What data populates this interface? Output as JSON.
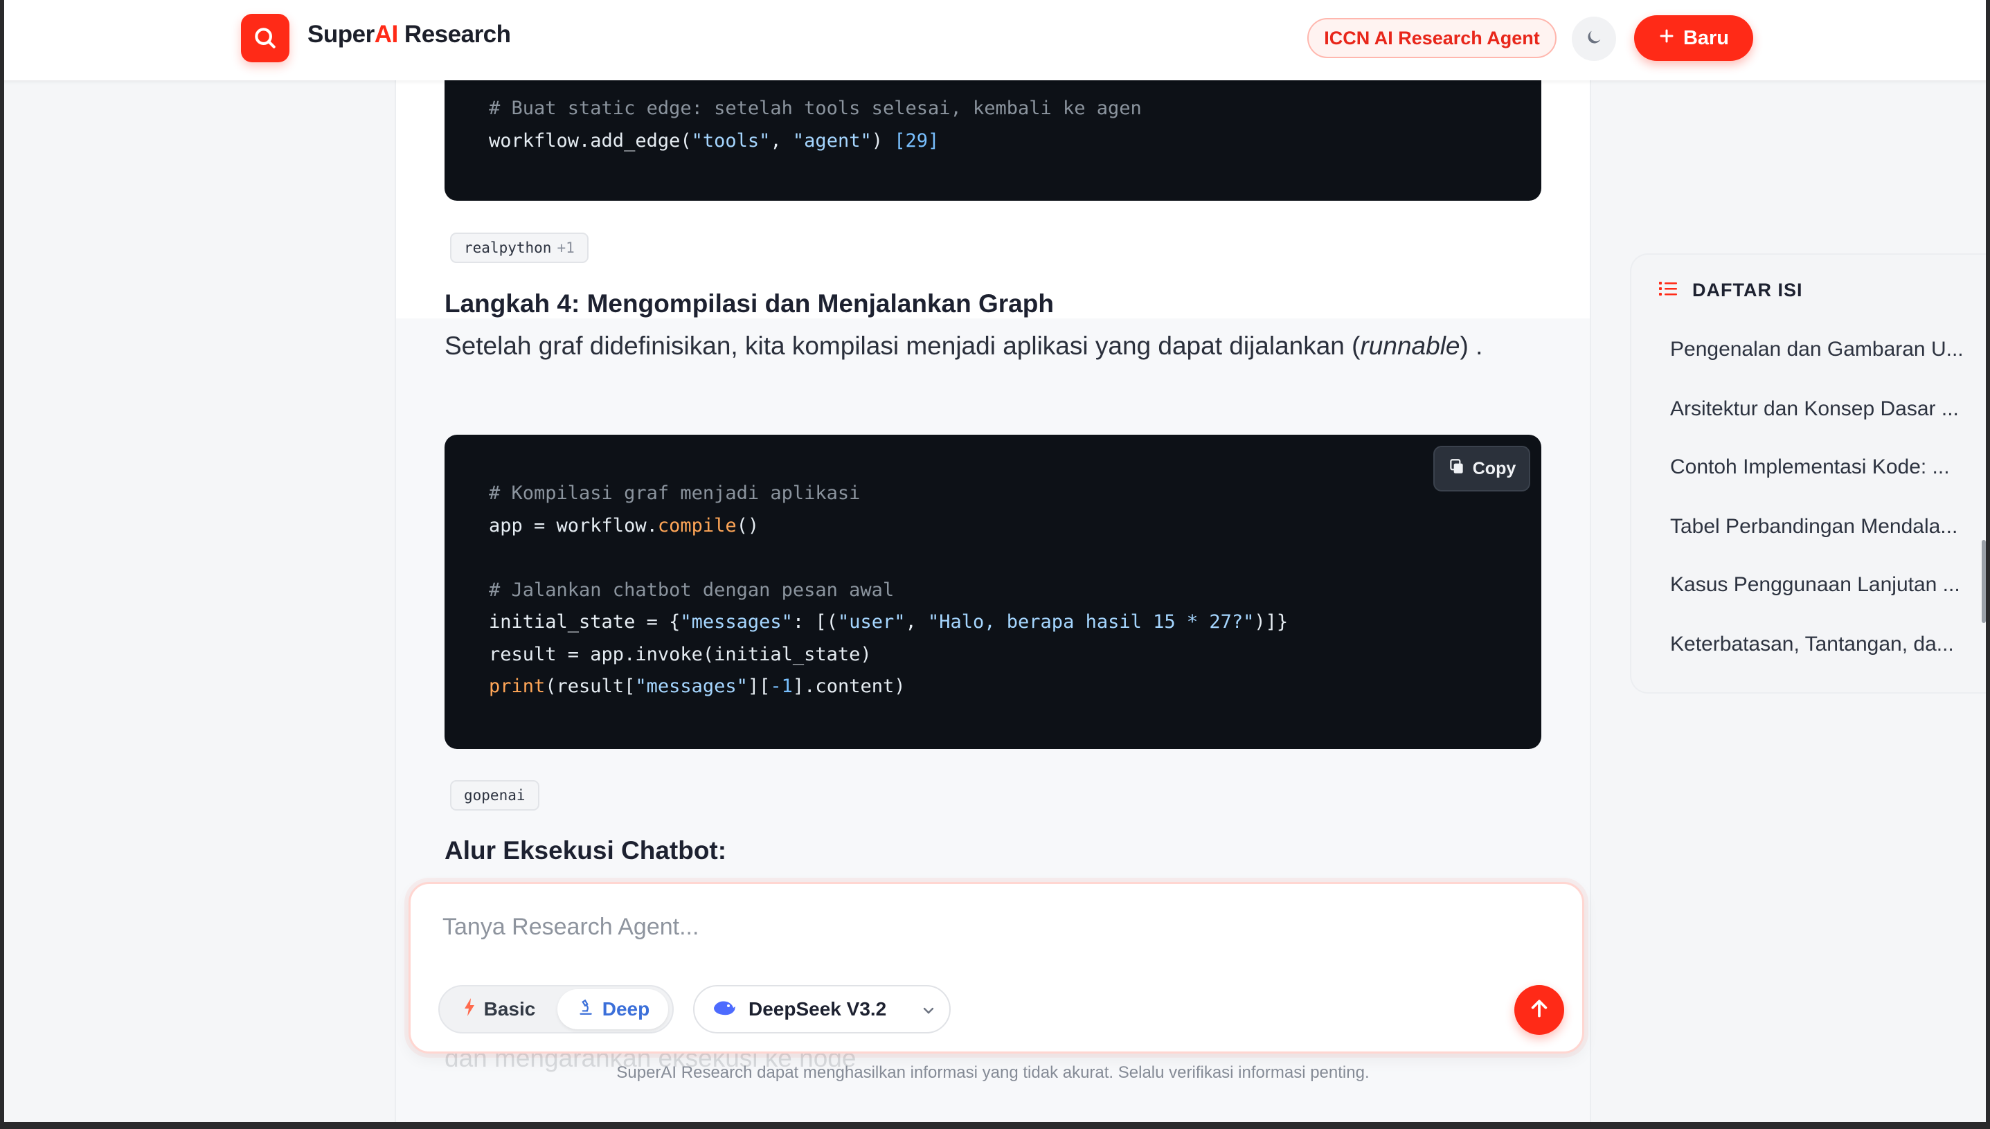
{
  "header": {
    "brand_prefix": "Super",
    "brand_accent": "AI",
    "brand_suffix": " Research",
    "agent_badge": "ICCN AI Research Agent",
    "new_button": "Baru"
  },
  "code_top": {
    "comment": "# Buat static edge: setelah tools selesai, kembali ke agen",
    "line_prefix": "workflow.add_edge(",
    "arg1": "\"tools\"",
    "sep": ", ",
    "arg2": "\"agent\"",
    "close": ") ",
    "cite": "[29]"
  },
  "chip_realpython": {
    "label": "realpython",
    "extra": "+1"
  },
  "step4": {
    "heading": "Langkah 4: Mengompilasi dan Menjalankan Graph",
    "para_before": "Setelah graf didefinisikan, kita kompilasi menjadi aplikasi yang dapat dijalankan (",
    "para_em": "runnable",
    "para_after": ") ."
  },
  "code_main": {
    "copy_label": "Copy",
    "l1": "# Kompilasi graf menjadi aplikasi",
    "l2_a": "app = workflow.",
    "l2_fn": "compile",
    "l2_b": "()",
    "l4": "# Jalankan chatbot dengan pesan awal",
    "l5_a": "initial_state = {",
    "l5_s1": "\"messages\"",
    "l5_b": ": [(",
    "l5_s2": "\"user\"",
    "l5_c": ", ",
    "l5_s3": "\"Halo, berapa hasil 15 * 27?\"",
    "l5_d": ")]}",
    "l6": "result = app.invoke(initial_state)",
    "l7_fn": "print",
    "l7_a": "(result[",
    "l7_s": "\"messages\"",
    "l7_b": "][",
    "l7_n": "-1",
    "l7_c": "].content)"
  },
  "chip_gopenai": {
    "label": "gopenai"
  },
  "alur_heading": "Alur Eksekusi Chatbot:",
  "ghost_line": "dan mengarahkan eksekusi ke node",
  "toc": {
    "title": "DAFTAR ISI",
    "items": [
      "Pengenalan dan Gambaran U...",
      "Arsitektur dan Konsep Dasar ...",
      "Contoh Implementasi Kode: ...",
      "Tabel Perbandingan Mendala...",
      "Kasus Penggunaan Lanjutan ...",
      "Keterbatasan, Tantangan, da..."
    ]
  },
  "composer": {
    "placeholder": "Tanya Research Agent...",
    "mode_basic": "Basic",
    "mode_deep": "Deep",
    "selected_mode": "Deep",
    "model": "DeepSeek V3.2"
  },
  "disclaimer": "SuperAI Research dapat menghasilkan informasi yang tidak akurat. Selalu verifikasi informasi penting.",
  "colors": {
    "accent": "#ff2a17",
    "code_bg": "#0d1117",
    "deep_blue": "#3b6fd9"
  }
}
